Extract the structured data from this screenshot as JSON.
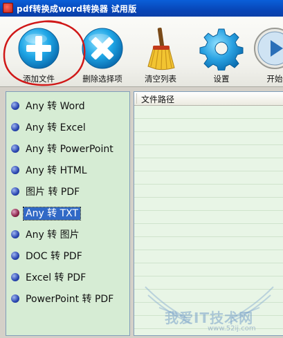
{
  "window": {
    "title": "pdf转换成word转换器 试用版"
  },
  "toolbar": {
    "buttons": [
      {
        "label": "添加文件",
        "icon": "add-icon"
      },
      {
        "label": "删除选择项",
        "icon": "delete-icon"
      },
      {
        "label": "清空列表",
        "icon": "broom-icon"
      },
      {
        "label": "设置",
        "icon": "gear-icon"
      },
      {
        "label": "开始",
        "icon": "play-icon"
      }
    ]
  },
  "conversions": [
    {
      "label": "Any 转 Word",
      "selected": false
    },
    {
      "label": "Any 转 Excel",
      "selected": false
    },
    {
      "label": "Any 转 PowerPoint",
      "selected": false
    },
    {
      "label": "Any 转 HTML",
      "selected": false
    },
    {
      "label": "图片 转 PDF",
      "selected": false
    },
    {
      "label": "Any 转 TXT",
      "selected": true
    },
    {
      "label": "Any 转 图片",
      "selected": false
    },
    {
      "label": "DOC 转 PDF",
      "selected": false
    },
    {
      "label": "Excel 转 PDF",
      "selected": false
    },
    {
      "label": "PowerPoint 转 PDF",
      "selected": false
    }
  ],
  "file_list": {
    "column_header": "文件路径"
  },
  "watermark": {
    "text": "我爱IT技术网",
    "sub": "www.52ij.com"
  },
  "colors": {
    "accent": "#3169c6",
    "panel_green": "#d6ecd4",
    "annotation": "#d01818"
  }
}
